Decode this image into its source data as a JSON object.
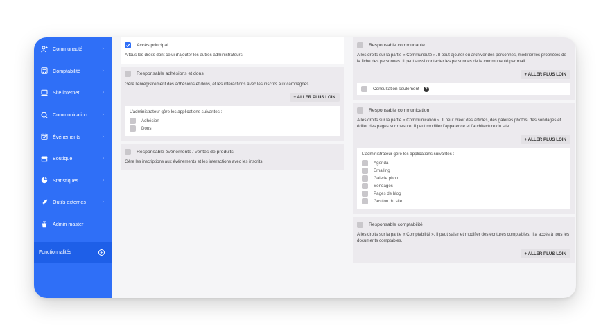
{
  "sidebar": {
    "items": [
      {
        "label": "Communauté",
        "icon": "people-icon"
      },
      {
        "label": "Comptabilité",
        "icon": "calculator-icon"
      },
      {
        "label": "Site internet",
        "icon": "monitor-icon"
      },
      {
        "label": "Communication",
        "icon": "chat-icon"
      },
      {
        "label": "Événements",
        "icon": "calendar-icon"
      },
      {
        "label": "Boutique",
        "icon": "shop-icon"
      },
      {
        "label": "Statistiques",
        "icon": "pie-chart-icon"
      },
      {
        "label": "Outils externes",
        "icon": "rocket-icon"
      },
      {
        "label": "Admin master",
        "icon": "admin-icon"
      }
    ],
    "features_label": "Fonctionnalités",
    "accent": "#2f6ff7"
  },
  "left": {
    "main_access": {
      "label": "Accès principal",
      "desc": "A tous les droits dont celui d'ajouter les autres administrateurs."
    },
    "adhesion": {
      "label": "Responsable adhésions et dons",
      "desc": "Gère l'enregistrement des adhésions et dons, et les interactions avec les inscrits aux campagnes.",
      "more": "+ ALLER PLUS LOIN",
      "apps_title": "L'administrateur gère les applications suivantes :",
      "apps": [
        "Adhésion",
        "Dons"
      ]
    },
    "events": {
      "label": "Responsable événements / ventes de produits",
      "desc": "Gère les inscriptions aux événements et les interactions avec les inscrits."
    }
  },
  "right": {
    "community": {
      "label": "Responsable communauté",
      "desc": "A les droits sur la partie « Communauté ». Il peut ajouter ou archiver des personnes, modifier les propriétés de la fiche des personnes. Il peut aussi contacter les personnes de la communauté par mail.",
      "more": "+ ALLER PLUS LOIN",
      "consult": "Consultation seulement",
      "help": "?"
    },
    "communication": {
      "label": "Responsable communication",
      "desc": "A les droits sur la partie « Communication ». Il peut créer des articles, des galeries photos, des sondages et éditer des pages sur mesure. Il peut modifier l'apparence et l'architecture du site",
      "more": "+ ALLER PLUS LOIN",
      "apps_title": "L'administrateur gère les applications suivantes :",
      "apps": [
        "Agenda",
        "Emailing",
        "Galerie photo",
        "Sondages",
        "Pages de blog",
        "Gestion du site"
      ]
    },
    "accounting": {
      "label": "Responsable comptabilité",
      "desc": "A les droits sur la partie « Comptabilité ». Il peut saisir et modifier des écritures comptables. Il a accès à tous les documents comptables.",
      "more": "+ ALLER PLUS LOIN"
    }
  }
}
